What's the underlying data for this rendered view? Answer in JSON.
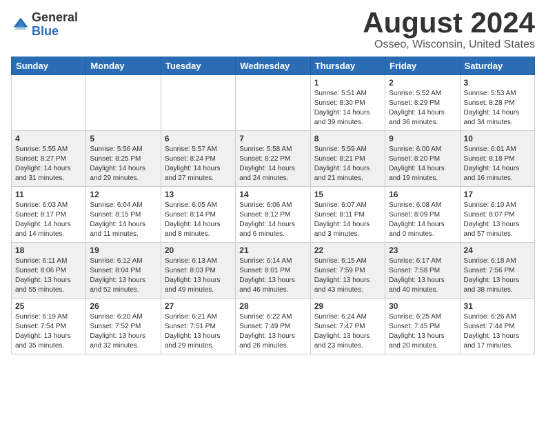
{
  "header": {
    "logo_general": "General",
    "logo_blue": "Blue",
    "title": "August 2024",
    "subtitle": "Osseo, Wisconsin, United States"
  },
  "calendar": {
    "weekdays": [
      "Sunday",
      "Monday",
      "Tuesday",
      "Wednesday",
      "Thursday",
      "Friday",
      "Saturday"
    ],
    "weeks": [
      [
        {
          "day": "",
          "info": ""
        },
        {
          "day": "",
          "info": ""
        },
        {
          "day": "",
          "info": ""
        },
        {
          "day": "",
          "info": ""
        },
        {
          "day": "1",
          "info": "Sunrise: 5:51 AM\nSunset: 8:30 PM\nDaylight: 14 hours\nand 39 minutes."
        },
        {
          "day": "2",
          "info": "Sunrise: 5:52 AM\nSunset: 8:29 PM\nDaylight: 14 hours\nand 36 minutes."
        },
        {
          "day": "3",
          "info": "Sunrise: 5:53 AM\nSunset: 8:28 PM\nDaylight: 14 hours\nand 34 minutes."
        }
      ],
      [
        {
          "day": "4",
          "info": "Sunrise: 5:55 AM\nSunset: 8:27 PM\nDaylight: 14 hours\nand 31 minutes."
        },
        {
          "day": "5",
          "info": "Sunrise: 5:56 AM\nSunset: 8:25 PM\nDaylight: 14 hours\nand 29 minutes."
        },
        {
          "day": "6",
          "info": "Sunrise: 5:57 AM\nSunset: 8:24 PM\nDaylight: 14 hours\nand 27 minutes."
        },
        {
          "day": "7",
          "info": "Sunrise: 5:58 AM\nSunset: 8:22 PM\nDaylight: 14 hours\nand 24 minutes."
        },
        {
          "day": "8",
          "info": "Sunrise: 5:59 AM\nSunset: 8:21 PM\nDaylight: 14 hours\nand 21 minutes."
        },
        {
          "day": "9",
          "info": "Sunrise: 6:00 AM\nSunset: 8:20 PM\nDaylight: 14 hours\nand 19 minutes."
        },
        {
          "day": "10",
          "info": "Sunrise: 6:01 AM\nSunset: 8:18 PM\nDaylight: 14 hours\nand 16 minutes."
        }
      ],
      [
        {
          "day": "11",
          "info": "Sunrise: 6:03 AM\nSunset: 8:17 PM\nDaylight: 14 hours\nand 14 minutes."
        },
        {
          "day": "12",
          "info": "Sunrise: 6:04 AM\nSunset: 8:15 PM\nDaylight: 14 hours\nand 11 minutes."
        },
        {
          "day": "13",
          "info": "Sunrise: 6:05 AM\nSunset: 8:14 PM\nDaylight: 14 hours\nand 8 minutes."
        },
        {
          "day": "14",
          "info": "Sunrise: 6:06 AM\nSunset: 8:12 PM\nDaylight: 14 hours\nand 6 minutes."
        },
        {
          "day": "15",
          "info": "Sunrise: 6:07 AM\nSunset: 8:11 PM\nDaylight: 14 hours\nand 3 minutes."
        },
        {
          "day": "16",
          "info": "Sunrise: 6:08 AM\nSunset: 8:09 PM\nDaylight: 14 hours\nand 0 minutes."
        },
        {
          "day": "17",
          "info": "Sunrise: 6:10 AM\nSunset: 8:07 PM\nDaylight: 13 hours\nand 57 minutes."
        }
      ],
      [
        {
          "day": "18",
          "info": "Sunrise: 6:11 AM\nSunset: 8:06 PM\nDaylight: 13 hours\nand 55 minutes."
        },
        {
          "day": "19",
          "info": "Sunrise: 6:12 AM\nSunset: 8:04 PM\nDaylight: 13 hours\nand 52 minutes."
        },
        {
          "day": "20",
          "info": "Sunrise: 6:13 AM\nSunset: 8:03 PM\nDaylight: 13 hours\nand 49 minutes."
        },
        {
          "day": "21",
          "info": "Sunrise: 6:14 AM\nSunset: 8:01 PM\nDaylight: 13 hours\nand 46 minutes."
        },
        {
          "day": "22",
          "info": "Sunrise: 6:15 AM\nSunset: 7:59 PM\nDaylight: 13 hours\nand 43 minutes."
        },
        {
          "day": "23",
          "info": "Sunrise: 6:17 AM\nSunset: 7:58 PM\nDaylight: 13 hours\nand 40 minutes."
        },
        {
          "day": "24",
          "info": "Sunrise: 6:18 AM\nSunset: 7:56 PM\nDaylight: 13 hours\nand 38 minutes."
        }
      ],
      [
        {
          "day": "25",
          "info": "Sunrise: 6:19 AM\nSunset: 7:54 PM\nDaylight: 13 hours\nand 35 minutes."
        },
        {
          "day": "26",
          "info": "Sunrise: 6:20 AM\nSunset: 7:52 PM\nDaylight: 13 hours\nand 32 minutes."
        },
        {
          "day": "27",
          "info": "Sunrise: 6:21 AM\nSunset: 7:51 PM\nDaylight: 13 hours\nand 29 minutes."
        },
        {
          "day": "28",
          "info": "Sunrise: 6:22 AM\nSunset: 7:49 PM\nDaylight: 13 hours\nand 26 minutes."
        },
        {
          "day": "29",
          "info": "Sunrise: 6:24 AM\nSunset: 7:47 PM\nDaylight: 13 hours\nand 23 minutes."
        },
        {
          "day": "30",
          "info": "Sunrise: 6:25 AM\nSunset: 7:45 PM\nDaylight: 13 hours\nand 20 minutes."
        },
        {
          "day": "31",
          "info": "Sunrise: 6:26 AM\nSunset: 7:44 PM\nDaylight: 13 hours\nand 17 minutes."
        }
      ]
    ]
  }
}
